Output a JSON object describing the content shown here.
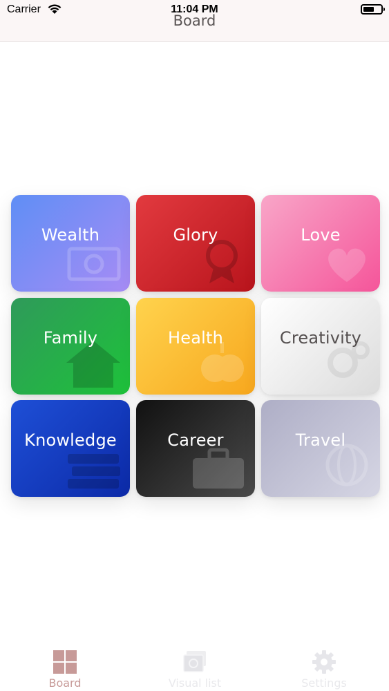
{
  "status_bar": {
    "carrier": "Carrier",
    "time": "11:04 PM"
  },
  "nav": {
    "title": "Board"
  },
  "tiles": [
    {
      "label": "Wealth",
      "icon": "money-icon",
      "gradient": [
        "#5f8ef5",
        "#a78cf5"
      ],
      "text_color": "#ffffff"
    },
    {
      "label": "Glory",
      "icon": "medal-icon",
      "gradient": [
        "#e23a3f",
        "#b8141c"
      ],
      "text_color": "#ffffff"
    },
    {
      "label": "Love",
      "icon": "hearts-icon",
      "gradient": [
        "#f8a6c8",
        "#f5559a"
      ],
      "text_color": "#ffffff"
    },
    {
      "label": "Family",
      "icon": "house-icon",
      "gradient": [
        "#2f9a5a",
        "#1ec23a"
      ],
      "text_color": "#ffffff"
    },
    {
      "label": "Health",
      "icon": "apple-icon",
      "gradient": [
        "#ffd34d",
        "#f7a71e"
      ],
      "text_color": "#ffffff"
    },
    {
      "label": "Creativity",
      "icon": "gears-icon",
      "gradient": [
        "#ffffff",
        "#dcdcdc"
      ],
      "text_color": "#555050"
    },
    {
      "label": "Knowledge",
      "icon": "books-icon",
      "gradient": [
        "#1e4fd6",
        "#0c2aa8"
      ],
      "text_color": "#ffffff"
    },
    {
      "label": "Career",
      "icon": "briefcase-icon",
      "gradient": [
        "#111111",
        "#4a4a4a"
      ],
      "text_color": "#ffffff"
    },
    {
      "label": "Travel",
      "icon": "globe-icon",
      "gradient": [
        "#aeaec6",
        "#d6d6e4"
      ],
      "text_color": "#ffffff"
    }
  ],
  "tab_bar": {
    "tabs": [
      {
        "label": "Board",
        "icon": "grid-icon",
        "color": "#c79a98",
        "selected": true
      },
      {
        "label": "Visual list",
        "icon": "photos-icon",
        "color": "#e9e9ec",
        "selected": false
      },
      {
        "label": "Settings",
        "icon": "gear-icon",
        "color": "#e9e9ec",
        "selected": false
      }
    ]
  }
}
